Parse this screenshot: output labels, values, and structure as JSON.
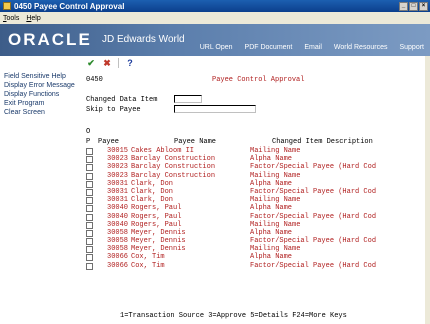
{
  "window": {
    "title": "0450    Payee Control Approval"
  },
  "menu": [
    {
      "label": "Tools",
      "accel": "T"
    },
    {
      "label": "Help",
      "accel": "H"
    }
  ],
  "banner": {
    "logo": "ORACLE",
    "product": "JD Edwards World",
    "links": [
      "URL Open",
      "PDF Document",
      "Email",
      "World Resources",
      "Support"
    ]
  },
  "sidebar": {
    "items": [
      "Field Sensitive Help",
      "Display Error Message",
      "Display Functions",
      "Exit Program",
      "Clear Screen"
    ]
  },
  "toolbar": {
    "ok_icon": "checkmark-icon",
    "cancel_icon": "x-icon",
    "help_icon": "question-icon"
  },
  "form": {
    "id": "0450",
    "title": "Payee Control Approval",
    "changed_data_item_label": "Changed Data Item",
    "changed_data_item_value": "",
    "skip_to_payee_label": "Skip to Payee",
    "skip_to_payee_value": ""
  },
  "grid": {
    "header_o": "O",
    "col_p": "P",
    "col_payee": "Payee",
    "col_name": "Payee Name",
    "col_desc": "Changed Item Description",
    "rows": [
      {
        "payee": "30015",
        "name": "Cakes Abloom II",
        "desc": "Mailing Name"
      },
      {
        "payee": "30023",
        "name": "Barclay Construction",
        "desc": "Alpha Name"
      },
      {
        "payee": "30023",
        "name": "Barclay Construction",
        "desc": "Factor/Special Payee (Hard Cod"
      },
      {
        "payee": "30023",
        "name": "Barclay Construction",
        "desc": "Mailing Name"
      },
      {
        "payee": "30031",
        "name": "Clark, Don",
        "desc": "Alpha Name"
      },
      {
        "payee": "30031",
        "name": "Clark, Don",
        "desc": "Factor/Special Payee (Hard Cod"
      },
      {
        "payee": "30031",
        "name": "Clark, Don",
        "desc": "Mailing Name"
      },
      {
        "payee": "30040",
        "name": "Rogers, Paul",
        "desc": "Alpha Name"
      },
      {
        "payee": "30040",
        "name": "Rogers, Paul",
        "desc": "Factor/Special Payee (Hard Cod"
      },
      {
        "payee": "30040",
        "name": "Rogers, Paul",
        "desc": "Mailing Name"
      },
      {
        "payee": "30058",
        "name": "Meyer, Dennis",
        "desc": "Alpha Name"
      },
      {
        "payee": "30058",
        "name": "Meyer, Dennis",
        "desc": "Factor/Special Payee (Hard Cod"
      },
      {
        "payee": "30058",
        "name": "Meyer, Dennis",
        "desc": "Mailing Name"
      },
      {
        "payee": "30066",
        "name": "Cox, Tim",
        "desc": "Alpha Name"
      },
      {
        "payee": "30066",
        "name": "Cox, Tim",
        "desc": "Factor/Special Payee (Hard Cod"
      }
    ]
  },
  "footer": {
    "keys": "1=Transaction Source  3=Approve  5=Details  F24=More Keys"
  },
  "colors": {
    "title_bar": "#0c3f8c",
    "banner": "#5b7eac",
    "data_text": "#b01e1e",
    "sidebar_text": "#1a3a6b"
  }
}
